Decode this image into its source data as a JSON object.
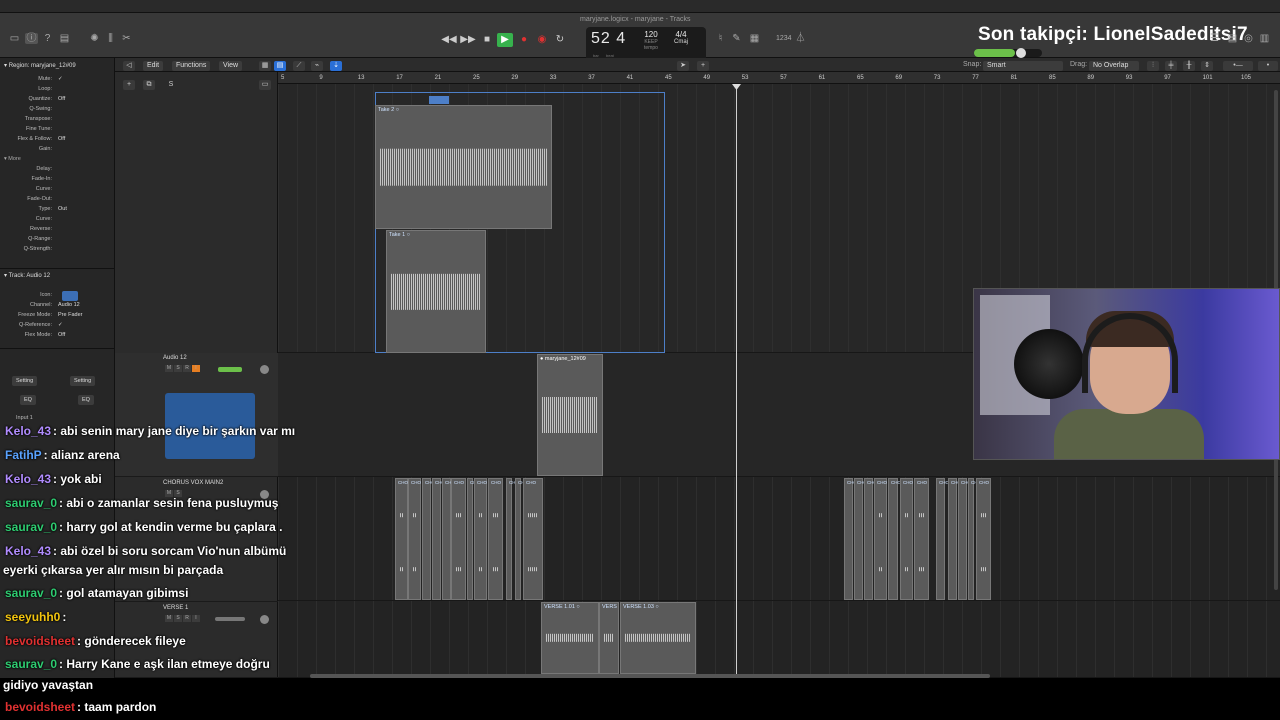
{
  "window": {
    "title": "maryjane.logicx - maryjane - Tracks"
  },
  "overlay": {
    "follower_label": "Son takipçi: LionelSadeditsi7"
  },
  "lcd": {
    "bar": "52",
    "beat": "4",
    "bar_label": "bar",
    "beat_label": "beat",
    "tempo": "120",
    "tempo_label": "KEEP",
    "tempo_sub": "tempo",
    "signature": "4/4",
    "key": "Cmaj"
  },
  "toolbar": {
    "edit": "Edit",
    "functions": "Functions",
    "view": "View",
    "snap_label": "Snap:",
    "snap_value": "Smart",
    "drag_label": "Drag:",
    "drag_value": "No Overlap",
    "s_button": "S"
  },
  "inspector": {
    "region_header": "Region: maryjane_12#09",
    "region_rows": [
      {
        "label": "Mute:",
        "value": "✓"
      },
      {
        "label": "Loop:",
        "value": ""
      },
      {
        "label": "Quantize:",
        "value": "Off"
      },
      {
        "label": "Q-Swing:",
        "value": ""
      },
      {
        "label": "Transpose:",
        "value": ""
      },
      {
        "label": "Fine Tune:",
        "value": ""
      },
      {
        "label": "Flex & Follow:",
        "value": "Off"
      },
      {
        "label": "Gain:",
        "value": ""
      }
    ],
    "more_header": "More",
    "more_rows": [
      {
        "label": "Delay:",
        "value": ""
      },
      {
        "label": "Fade-In:",
        "value": ""
      },
      {
        "label": "Curve:",
        "value": ""
      },
      {
        "label": "Fade-Out:",
        "value": ""
      },
      {
        "label": "Type:",
        "value": "Out"
      },
      {
        "label": "Curve:",
        "value": ""
      },
      {
        "label": "Reverse:",
        "value": ""
      },
      {
        "label": "Q-Range:",
        "value": ""
      },
      {
        "label": "Q-Strength:",
        "value": ""
      }
    ],
    "track_header": "Track: Audio 12",
    "track_rows": [
      {
        "label": "Icon:",
        "value": ""
      },
      {
        "label": "Channel:",
        "value": "Audio 12"
      },
      {
        "label": "Freeze Mode:",
        "value": "Pre Fader"
      },
      {
        "label": "Q-Reference:",
        "value": "✓"
      },
      {
        "label": "Flex Mode:",
        "value": "Off"
      }
    ],
    "setting_left": "Setting",
    "setting_right": "Setting",
    "eq_left": "EQ",
    "eq_right": "EQ",
    "input_label": "Input 1"
  },
  "tracks": [
    {
      "name": "Audio 12"
    },
    {
      "name": "CHORUS VOX MAIN2"
    },
    {
      "name": "VERSE 1"
    }
  ],
  "ruler": [
    "5",
    "9",
    "13",
    "17",
    "21",
    "25",
    "29",
    "33",
    "37",
    "41",
    "45",
    "49",
    "53",
    "57",
    "61",
    "65",
    "69",
    "73",
    "77",
    "81",
    "85",
    "89",
    "93",
    "97",
    "101",
    "105"
  ],
  "regions": {
    "take2": "Take 2",
    "take1": "Take 1",
    "main": "maryjane_12#09",
    "chorus_short": "CHO",
    "verse_a": "VERSE 1.01",
    "verse_b": "VERS",
    "verse_c": "VERSE 1.03"
  },
  "chat": [
    {
      "user": "Kelo_43",
      "color": "#b18cff",
      "text": ": abi senin mary jane diye bir şarkın var mı"
    },
    {
      "user": "FatihP",
      "color": "#5aa3ff",
      "text": ": alianz arena"
    },
    {
      "user": "Kelo_43",
      "color": "#b18cff",
      "text": ": yok abi"
    },
    {
      "user": "saurav_0",
      "color": "#2ecc71",
      "text": ": abi o zamanlar sesin fena pusluymuş"
    },
    {
      "user": "saurav_0",
      "color": "#2ecc71",
      "text": ": harry gol at kendin verme bu çaplara ."
    },
    {
      "user": "Kelo_43",
      "color": "#b18cff",
      "text": ": abi özel bi soru sorcam Vio'nun albümü"
    },
    {
      "user": "",
      "color": "#ffffff",
      "text": "eyerki çıkarsa yer alır mısın bi parçada"
    },
    {
      "user": "saurav_0",
      "color": "#2ecc71",
      "text": ": gol atamayan gibimsi"
    },
    {
      "user": "seeyuhh0",
      "color": "#f1c40f",
      "text": ":"
    },
    {
      "user": "bevoidsheet",
      "color": "#e03131",
      "text": ": gönderecek fileye"
    },
    {
      "user": "saurav_0",
      "color": "#2ecc71",
      "text": ": Harry Kane e aşk ilan etmeye doğru"
    },
    {
      "user": "",
      "color": "#ffffff",
      "text": "gidiyo yavaştan"
    },
    {
      "user": "bevoidsheet",
      "color": "#e03131",
      "text": ": taam pardon"
    }
  ]
}
